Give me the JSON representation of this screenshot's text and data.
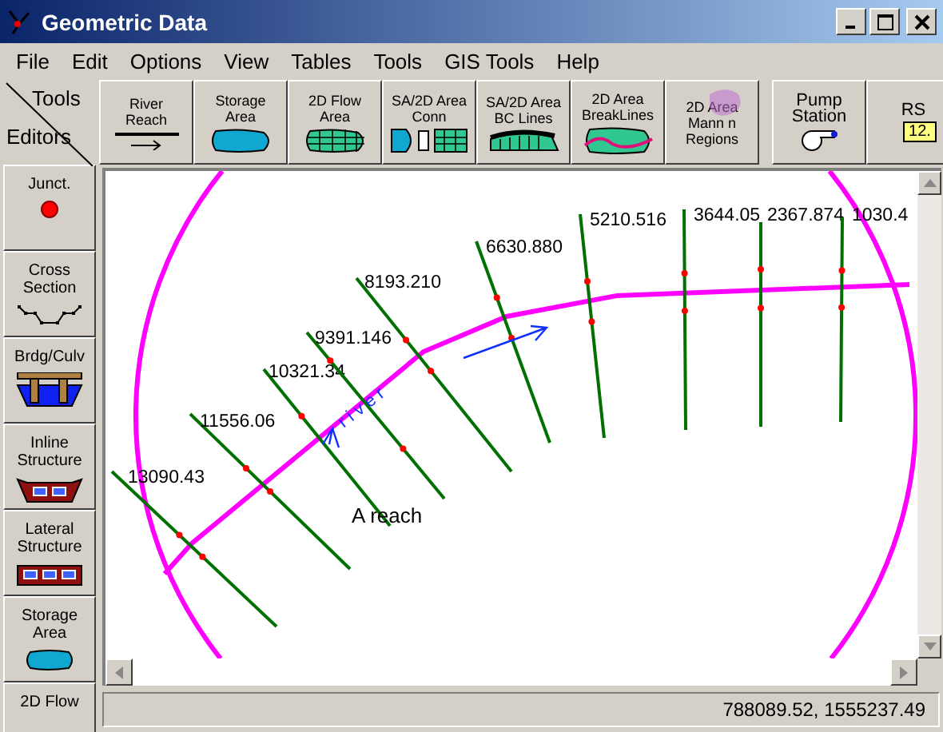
{
  "window": {
    "title": "Geometric Data"
  },
  "menu": [
    "File",
    "Edit",
    "Options",
    "View",
    "Tables",
    "Tools",
    "GIS Tools",
    "Help"
  ],
  "toolbar": {
    "corner": {
      "top": "Tools",
      "bottom": "Editors"
    },
    "tools": [
      {
        "lines": [
          "River",
          "Reach"
        ],
        "kind": "reach"
      },
      {
        "lines": [
          "Storage",
          "Area"
        ],
        "kind": "storage"
      },
      {
        "lines": [
          "2D Flow",
          "Area"
        ],
        "kind": "flow"
      },
      {
        "lines": [
          "SA/2D Area",
          "Conn"
        ],
        "kind": "conn"
      },
      {
        "lines": [
          "SA/2D Area",
          "BC Lines"
        ],
        "kind": "bc"
      },
      {
        "lines": [
          "2D Area",
          "BreakLines"
        ],
        "kind": "breaklines"
      },
      {
        "lines": [
          "2D Area",
          "Mann n",
          "Regions"
        ],
        "kind": "mann"
      },
      {
        "lines": [
          "Pump",
          "Station"
        ],
        "kind": "pump"
      },
      {
        "lines": [
          "RS"
        ],
        "kind": "rs",
        "badge": "12."
      }
    ]
  },
  "editors": [
    {
      "lines": [
        "Junct."
      ],
      "kind": "junction"
    },
    {
      "lines": [
        "Cross",
        "Section"
      ],
      "kind": "xs"
    },
    {
      "lines": [
        "Brdg/Culv"
      ],
      "kind": "bridge"
    },
    {
      "lines": [
        "Inline",
        "Structure"
      ],
      "kind": "inline"
    },
    {
      "lines": [
        "Lateral",
        "Structure"
      ],
      "kind": "lateral"
    },
    {
      "lines": [
        "Storage",
        "Area"
      ],
      "kind": "storage"
    },
    {
      "lines": [
        "2D Flow"
      ],
      "kind": "flow"
    }
  ],
  "canvas": {
    "river_label": "river",
    "reach_label": "A reach",
    "cross_sections": [
      {
        "station": "13090.43"
      },
      {
        "station": "11556.06"
      },
      {
        "station": "10321.34"
      },
      {
        "station": "9391.146"
      },
      {
        "station": "8193.210"
      },
      {
        "station": "6630.880"
      },
      {
        "station": "5210.516"
      },
      {
        "station": "3644.05"
      },
      {
        "station": "2367.874"
      },
      {
        "station": "1030.4"
      }
    ]
  },
  "status_bar": {
    "coordinates": "788089.52, 1555237.49"
  }
}
